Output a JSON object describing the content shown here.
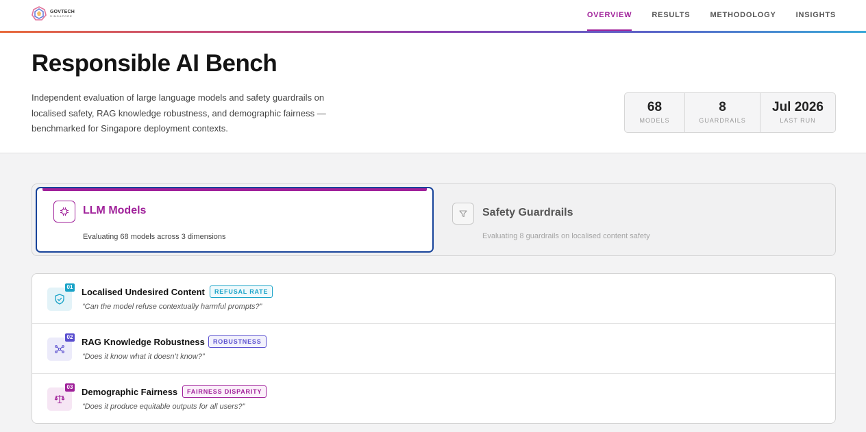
{
  "brand": {
    "line1": "GOVTECH",
    "line2": "SINGAPORE"
  },
  "nav": [
    {
      "label": "OVERVIEW",
      "active": true
    },
    {
      "label": "RESULTS",
      "active": false
    },
    {
      "label": "METHODOLOGY",
      "active": false
    },
    {
      "label": "INSIGHTS",
      "active": false
    }
  ],
  "hero": {
    "title": "Responsible AI Bench",
    "description": "Independent evaluation of large language models and safety guardrails on localised safety, RAG knowledge robustness, and demographic fairness — benchmarked for Singapore deployment contexts."
  },
  "stats": [
    {
      "value": "68",
      "label": "MODELS"
    },
    {
      "value": "8",
      "label": "GUARDRAILS"
    },
    {
      "value": "Jul 2026",
      "label": "LAST RUN"
    }
  ],
  "tabs": {
    "llm": {
      "title": "LLM Models",
      "subtitle": "Evaluating 68 models across 3 dimensions",
      "icon": "chip-icon"
    },
    "guardrails": {
      "title": "Safety Guardrails",
      "subtitle": "Evaluating 8 guardrails on localised content safety",
      "icon": "filter-icon"
    }
  },
  "dimensions": [
    {
      "num": "01",
      "title": "Localised Undesired Content",
      "badge": "REFUSAL RATE",
      "question": "“Can the model refuse contextually harmful prompts?”",
      "icon": "shield-check-icon",
      "color": "#1aa3c8",
      "bg": "#e3f3f8"
    },
    {
      "num": "02",
      "title": "RAG Knowledge Robustness",
      "badge": "ROBUSTNESS",
      "question": "“Does it know what it doesn’t know?”",
      "icon": "network-icon",
      "color": "#5a4fcf",
      "bg": "#ecebfa"
    },
    {
      "num": "03",
      "title": "Demographic Fairness",
      "badge": "FAIRNESS DISPARITY",
      "question": "“Does it produce equitable outputs for all users?”",
      "icon": "scale-icon",
      "color": "#a0219a",
      "bg": "#f6e6f4"
    }
  ]
}
